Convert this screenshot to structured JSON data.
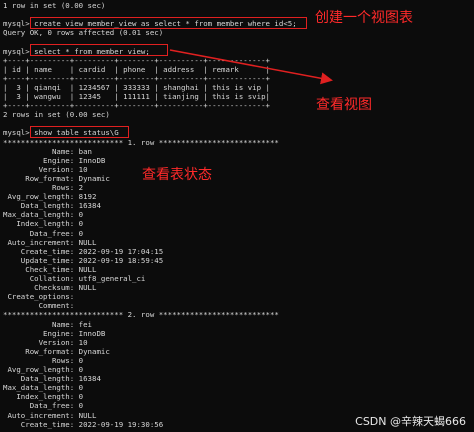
{
  "terminal": {
    "lines": [
      "1 row in set (0.00 sec)",
      "",
      "mysql> create view member_view as select * from member where id<5;",
      "Query OK, 0 rows affected (0.01 sec)",
      "",
      "mysql> select * from member_view;",
      "+----+---------+---------+--------+----------+-------------+",
      "| id | name    | cardid  | phone  | address  | remark      |",
      "+----+---------+---------+--------+----------+-------------+",
      "|  3 | qianqi  | 1234567 | 333333 | shanghai | this is vip |",
      "|  3 | wangwu  | 12345   | 111111 | tianjing | this is svip|",
      "+----+---------+---------+--------+----------+-------------+",
      "2 rows in set (0.00 sec)",
      "",
      "mysql> show table status\\G",
      "*************************** 1. row ***************************",
      "           Name: ban",
      "         Engine: InnoDB",
      "        Version: 10",
      "     Row_format: Dynamic",
      "           Rows: 2",
      " Avg_row_length: 8192",
      "    Data_length: 16384",
      "Max_data_length: 0",
      "   Index_length: 0",
      "      Data_free: 0",
      " Auto_increment: NULL",
      "    Create_time: 2022-09-19 17:04:15",
      "    Update_time: 2022-09-19 18:59:45",
      "     Check_time: NULL",
      "      Collation: utf8_general_ci",
      "       Checksum: NULL",
      " Create_options:",
      "        Comment:",
      "*************************** 2. row ***************************",
      "           Name: fei",
      "         Engine: InnoDB",
      "        Version: 10",
      "     Row_format: Dynamic",
      "           Rows: 0",
      " Avg_row_length: 0",
      "    Data_length: 16384",
      "Max_data_length: 0",
      "   Index_length: 0",
      "      Data_free: 0",
      " Auto_increment: NULL",
      "    Create_time: 2022-09-19 19:30:56"
    ]
  },
  "annotations": {
    "create_view": "创建一个视图表",
    "view_view": "查看视图",
    "view_status": "查看表状态"
  },
  "watermark": "CSDN @辛辣天蝎666",
  "colors": {
    "background": "#0c0c0c",
    "text": "#d8d8d8",
    "annotation": "#ff2a2a"
  }
}
